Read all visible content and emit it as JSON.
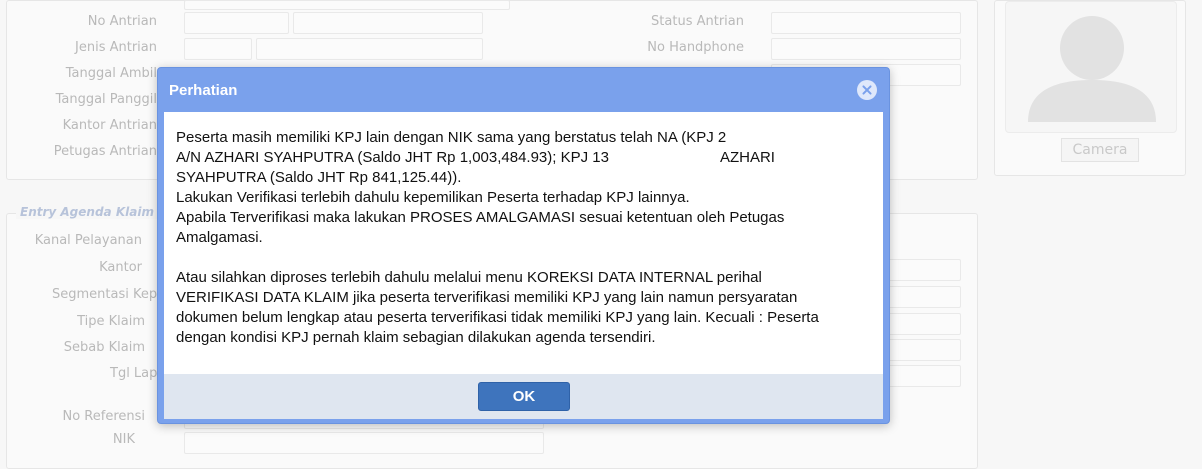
{
  "form": {
    "labels_top_left": [
      "No Antrian",
      "Jenis Antrian",
      "Tanggal Ambil",
      "Tanggal Panggil",
      "Kantor Antrian",
      "Petugas Antrian"
    ],
    "labels_top_right": [
      "Status Antrian",
      "No Handphone"
    ],
    "section_legend": "Entry Agenda Klaim",
    "labels_agenda": [
      "Kanal Pelayanan",
      "Kantor",
      "Segmentasi Kepsertaan",
      "Tipe Klaim",
      "Sebab Klaim",
      "Tgl Lapor"
    ],
    "labels_bottom": [
      "No Referensi",
      "NIK"
    ],
    "camera_label": "Camera"
  },
  "dialog": {
    "title": "Perhatian",
    "close_icon": "close-circle-icon",
    "paragraph1_line1": "Peserta masih memiliki KPJ lain dengan NIK sama yang berstatus telah NA (KPJ 2",
    "paragraph1_line2": "A/N AZHARI SYAHPUTRA (Saldo JHT Rp 1,003,484.93); KPJ 13",
    "paragraph1_line2b": "AZHARI",
    "paragraph1_line3": "SYAHPUTRA (Saldo JHT Rp 841,125.44)).",
    "paragraph1_line4": "Lakukan Verifikasi terlebih dahulu kepemilikan Peserta terhadap KPJ lainnya.",
    "paragraph1_line5": "Apabila Terverifikasi maka lakukan PROSES AMALGAMASI sesuai ketentuan oleh Petugas",
    "paragraph1_line6": "Amalgamasi.",
    "paragraph2_line1": "Atau silahkan diproses terlebih dahulu melalui menu KOREKSI DATA INTERNAL perihal",
    "paragraph2_line2": "VERIFIKASI DATA KLAIM jika peserta terverifikasi memiliki KPJ yang lain namun persyaratan",
    "paragraph2_line3": "dokumen belum lengkap atau peserta terverifikasi tidak memiliki KPJ yang lain. Kecuali : Peserta",
    "paragraph2_line4": "dengan kondisi KPJ pernah klaim sebagian dilakukan agenda tersendiri.",
    "ok_label": "OK"
  },
  "colors": {
    "dialog_frame": "#7aa1ec",
    "ok_button": "#3e74bd",
    "footer": "#dfe6f0"
  }
}
